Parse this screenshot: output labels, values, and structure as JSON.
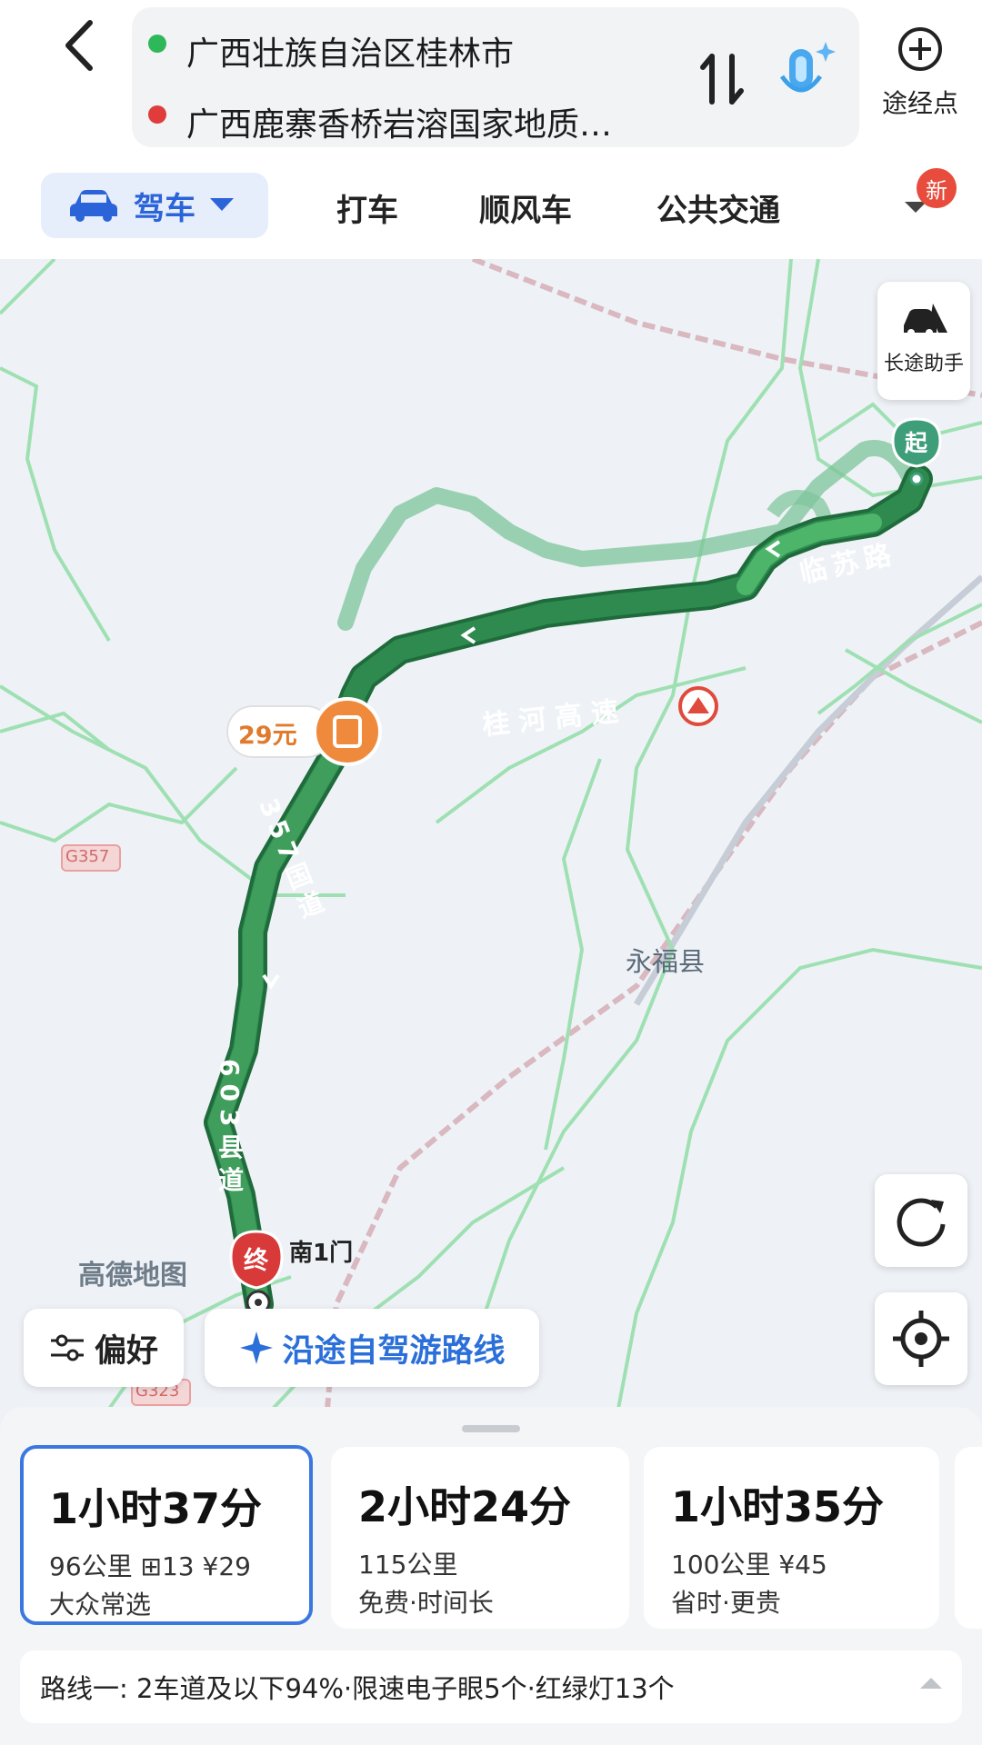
{
  "header": {
    "origin": "广西壮族自治区桂林市",
    "destination": "广西鹿寨香桥岩溶国家地质…",
    "waypoint_label": "途经点",
    "origin_color": "#2fb85a",
    "destination_color": "#e03c3c"
  },
  "modes": {
    "active": "驾车",
    "items": [
      "打车",
      "顺风车",
      "公共交通"
    ],
    "badge": "新"
  },
  "map": {
    "longtrip_label": "长途助手",
    "toll_label": "29元",
    "road_labels": [
      "临苏路",
      "桂河高速",
      "357国道",
      "603县道"
    ],
    "county_label": "永福县",
    "shield_label": "G357",
    "shield_label_2": "G323",
    "start_marker": "起",
    "end_marker": "终",
    "end_poi": "南1门",
    "logo": "高德地图",
    "route_color": "#2e8a4f",
    "alt_route_color": "#7cc49a"
  },
  "actions": {
    "preference": "偏好",
    "selfdrive": "沿途自驾游路线"
  },
  "routes": [
    {
      "time": "1小时37分",
      "meta": "96公里  ⊞13  ¥29",
      "tag": "大众常选"
    },
    {
      "time": "2小时24分",
      "meta": "115公里",
      "tag": "免费·时间长"
    },
    {
      "time": "1小时35分",
      "meta": "100公里  ¥45",
      "tag": "省时·更贵"
    }
  ],
  "summary": "路线一:  2车道及以下94%·限速电子眼5个·红绿灯13个"
}
